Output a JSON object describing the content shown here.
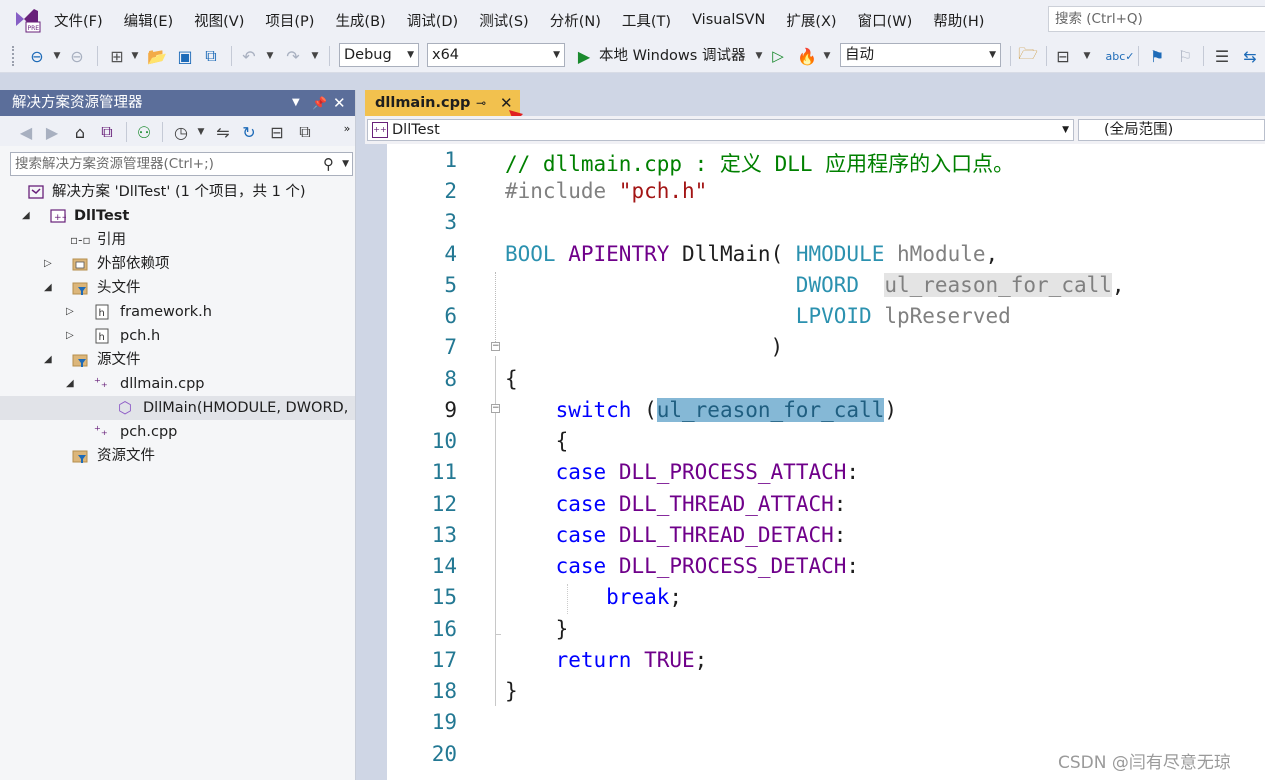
{
  "menu": {
    "items": [
      "文件(F)",
      "编辑(E)",
      "视图(V)",
      "项目(P)",
      "生成(B)",
      "调试(D)",
      "测试(S)",
      "分析(N)",
      "工具(T)",
      "VisualSVN",
      "扩展(X)",
      "窗口(W)",
      "帮助(H)"
    ],
    "search_placeholder": "搜索 (Ctrl+Q)"
  },
  "toolbar": {
    "config": "Debug",
    "platform": "x64",
    "run_label": "本地 Windows 调试器",
    "mode": "自动"
  },
  "solution_explorer": {
    "title": "解决方案资源管理器",
    "search_placeholder": "搜索解决方案资源管理器(Ctrl+;)",
    "tree": [
      {
        "label": "解决方案 'DllTest' (1 个项目，共 1 个)"
      },
      {
        "label": "DllTest"
      },
      {
        "label": "引用"
      },
      {
        "label": "外部依赖项"
      },
      {
        "label": "头文件"
      },
      {
        "label": "framework.h"
      },
      {
        "label": "pch.h"
      },
      {
        "label": "源文件"
      },
      {
        "label": "dllmain.cpp"
      },
      {
        "label": "DllMain(HMODULE, DWORD,"
      },
      {
        "label": "pch.cpp"
      },
      {
        "label": "资源文件"
      }
    ]
  },
  "editor": {
    "tab": "dllmain.cpp",
    "nav_project": "DllTest",
    "nav_scope": "(全局范围)",
    "line_numbers": [
      "1",
      "2",
      "3",
      "4",
      "5",
      "6",
      "7",
      "8",
      "9",
      "10",
      "11",
      "12",
      "13",
      "14",
      "15",
      "16",
      "17",
      "18",
      "19",
      "20"
    ],
    "code": {
      "l1": "// dllmain.cpp : 定义 DLL 应用程序的入口点。",
      "l2_pp": "#include ",
      "l2_str": "\"pch.h\"",
      "l4_a": "BOOL",
      "l4_b": "APIENTRY",
      "l4_c": "DllMain",
      "l4_d": "HMODULE",
      "l4_e": "hModule",
      "l5_a": "DWORD",
      "l5_b": "ul_reason_for_call",
      "l6_a": "LPVOID",
      "l6_b": "lpReserved",
      "l9_kw": "switch",
      "l9_id": "ul_reason_for_call",
      "l11": "DLL_PROCESS_ATTACH",
      "l12": "DLL_THREAD_ATTACH",
      "l13": "DLL_THREAD_DETACH",
      "l14": "DLL_PROCESS_DETACH",
      "case_kw": "case",
      "l15": "break",
      "l17_kw": "return",
      "l17_val": "TRUE"
    }
  },
  "watermark": "CSDN @闫有尽意无琼"
}
